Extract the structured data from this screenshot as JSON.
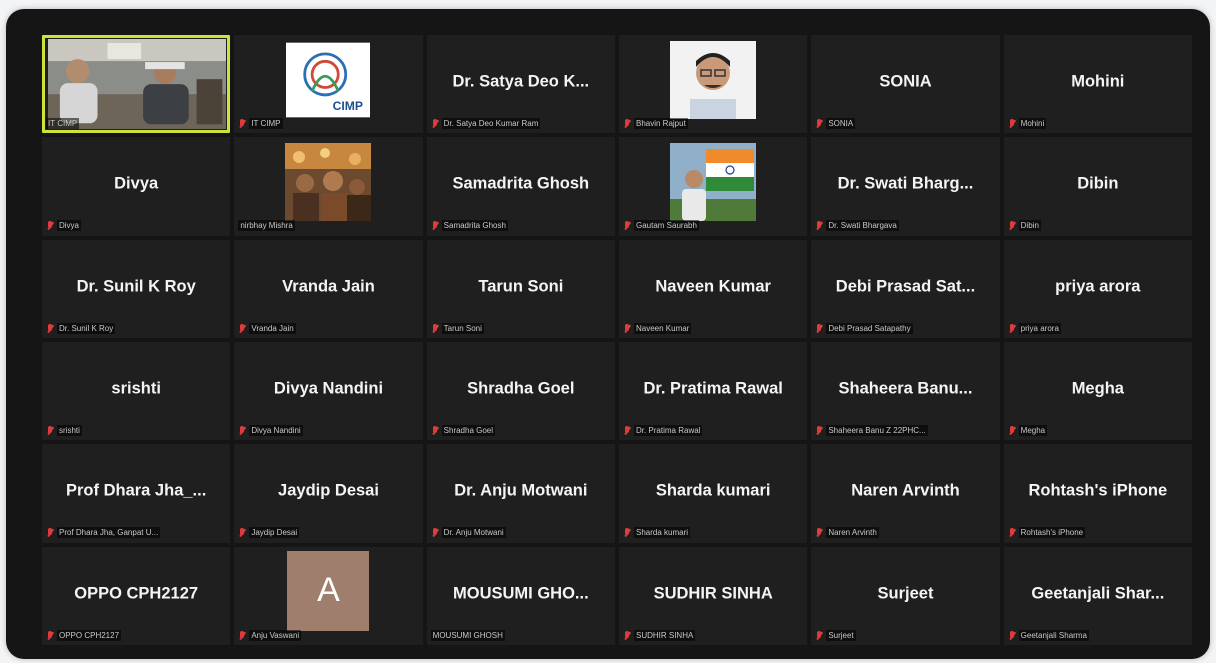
{
  "participants": [
    {
      "display": "",
      "label": "IT CIMP",
      "muted": false,
      "type": "video-room",
      "active": true
    },
    {
      "display": "",
      "label": "IT CIMP",
      "muted": true,
      "type": "logo"
    },
    {
      "display": "Dr. Satya Deo K...",
      "label": "Dr. Satya Deo Kumar Ram",
      "muted": true,
      "type": "name"
    },
    {
      "display": "",
      "label": "Bhavin Rajput",
      "muted": true,
      "type": "photo-man"
    },
    {
      "display": "SONIA",
      "label": "SONIA",
      "muted": true,
      "type": "name"
    },
    {
      "display": "Mohini",
      "label": "Mohini",
      "muted": true,
      "type": "name"
    },
    {
      "display": "Divya",
      "label": "Divya",
      "muted": true,
      "type": "name"
    },
    {
      "display": "",
      "label": "nirbhay Mishra",
      "muted": false,
      "type": "photo-crowd"
    },
    {
      "display": "Samadrita Ghosh",
      "label": "Samadrita Ghosh",
      "muted": true,
      "type": "name"
    },
    {
      "display": "",
      "label": "Gautam Saurabh",
      "muted": true,
      "type": "photo-flag"
    },
    {
      "display": "Dr. Swati Bharg...",
      "label": "Dr. Swati Bhargava",
      "muted": true,
      "type": "name"
    },
    {
      "display": "Dibin",
      "label": "Dibin",
      "muted": true,
      "type": "name"
    },
    {
      "display": "Dr. Sunil K Roy",
      "label": "Dr. Sunil K Roy",
      "muted": true,
      "type": "name"
    },
    {
      "display": "Vranda Jain",
      "label": "Vranda Jain",
      "muted": true,
      "type": "name"
    },
    {
      "display": "Tarun Soni",
      "label": "Tarun Soni",
      "muted": true,
      "type": "name"
    },
    {
      "display": "Naveen Kumar",
      "label": "Naveen Kumar",
      "muted": true,
      "type": "name"
    },
    {
      "display": "Debi Prasad Sat...",
      "label": "Debi Prasad Satapathy",
      "muted": true,
      "type": "name"
    },
    {
      "display": "priya arora",
      "label": "priya arora",
      "muted": true,
      "type": "name"
    },
    {
      "display": "srishti",
      "label": "srishti",
      "muted": true,
      "type": "name"
    },
    {
      "display": "Divya Nandini",
      "label": "Divya Nandini",
      "muted": true,
      "type": "name"
    },
    {
      "display": "Shradha Goel",
      "label": "Shradha Goel",
      "muted": true,
      "type": "name"
    },
    {
      "display": "Dr. Pratima Rawal",
      "label": "Dr. Pratima Rawal",
      "muted": true,
      "type": "name"
    },
    {
      "display": "Shaheera Banu...",
      "label": "Shaheera Banu Z 22PHC...",
      "muted": true,
      "type": "name"
    },
    {
      "display": "Megha",
      "label": "Megha",
      "muted": true,
      "type": "name"
    },
    {
      "display": "Prof Dhara Jha_...",
      "label": "Prof Dhara Jha, Ganpat U...",
      "muted": true,
      "type": "name"
    },
    {
      "display": "Jaydip Desai",
      "label": "Jaydip Desai",
      "muted": true,
      "type": "name"
    },
    {
      "display": "Dr. Anju Motwani",
      "label": "Dr. Anju Motwani",
      "muted": true,
      "type": "name"
    },
    {
      "display": "Sharda kumari",
      "label": "Sharda kumari",
      "muted": true,
      "type": "name"
    },
    {
      "display": "Naren Arvinth",
      "label": "Naren Arvinth",
      "muted": true,
      "type": "name"
    },
    {
      "display": "Rohtash's iPhone",
      "label": "Rohtash's iPhone",
      "muted": true,
      "type": "name"
    },
    {
      "display": "OPPO CPH2127",
      "label": "OPPO CPH2127",
      "muted": true,
      "type": "name"
    },
    {
      "display": "A",
      "label": "Anju Vaswani",
      "muted": true,
      "type": "avatar"
    },
    {
      "display": "MOUSUMI GHO...",
      "label": "MOUSUMI GHOSH",
      "muted": false,
      "type": "name"
    },
    {
      "display": "SUDHIR SINHA",
      "label": "SUDHIR SINHA",
      "muted": true,
      "type": "name"
    },
    {
      "display": "Surjeet",
      "label": "Surjeet",
      "muted": true,
      "type": "name"
    },
    {
      "display": "Geetanjali Shar...",
      "label": "Geetanjali Sharma",
      "muted": true,
      "type": "name"
    }
  ],
  "logo": {
    "text": "CIMP"
  },
  "colors": {
    "active_border": "#cde33b",
    "mute_red": "#e23b3b",
    "avatar_bg": "#a07e6d",
    "tile_bg": "#1f1f1f"
  }
}
